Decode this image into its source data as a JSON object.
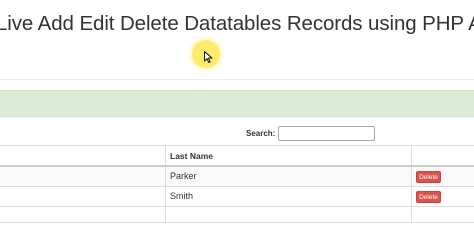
{
  "page": {
    "title": "Live Add Edit Delete Datatables Records using PHP Ajax"
  },
  "search": {
    "label": "Search:",
    "value": "",
    "placeholder": ""
  },
  "table": {
    "columns": [
      "Last Name"
    ],
    "rows": [
      {
        "last_name": "Parker",
        "action_label": "Delete"
      },
      {
        "last_name": "Smith",
        "action_label": "Delete"
      }
    ]
  },
  "colors": {
    "accent_bar": "#dcebd6",
    "delete_button": "#d9534f",
    "cursor_highlight": "#ffe850"
  },
  "icons": {
    "cursor": "mouse-pointer-icon"
  }
}
